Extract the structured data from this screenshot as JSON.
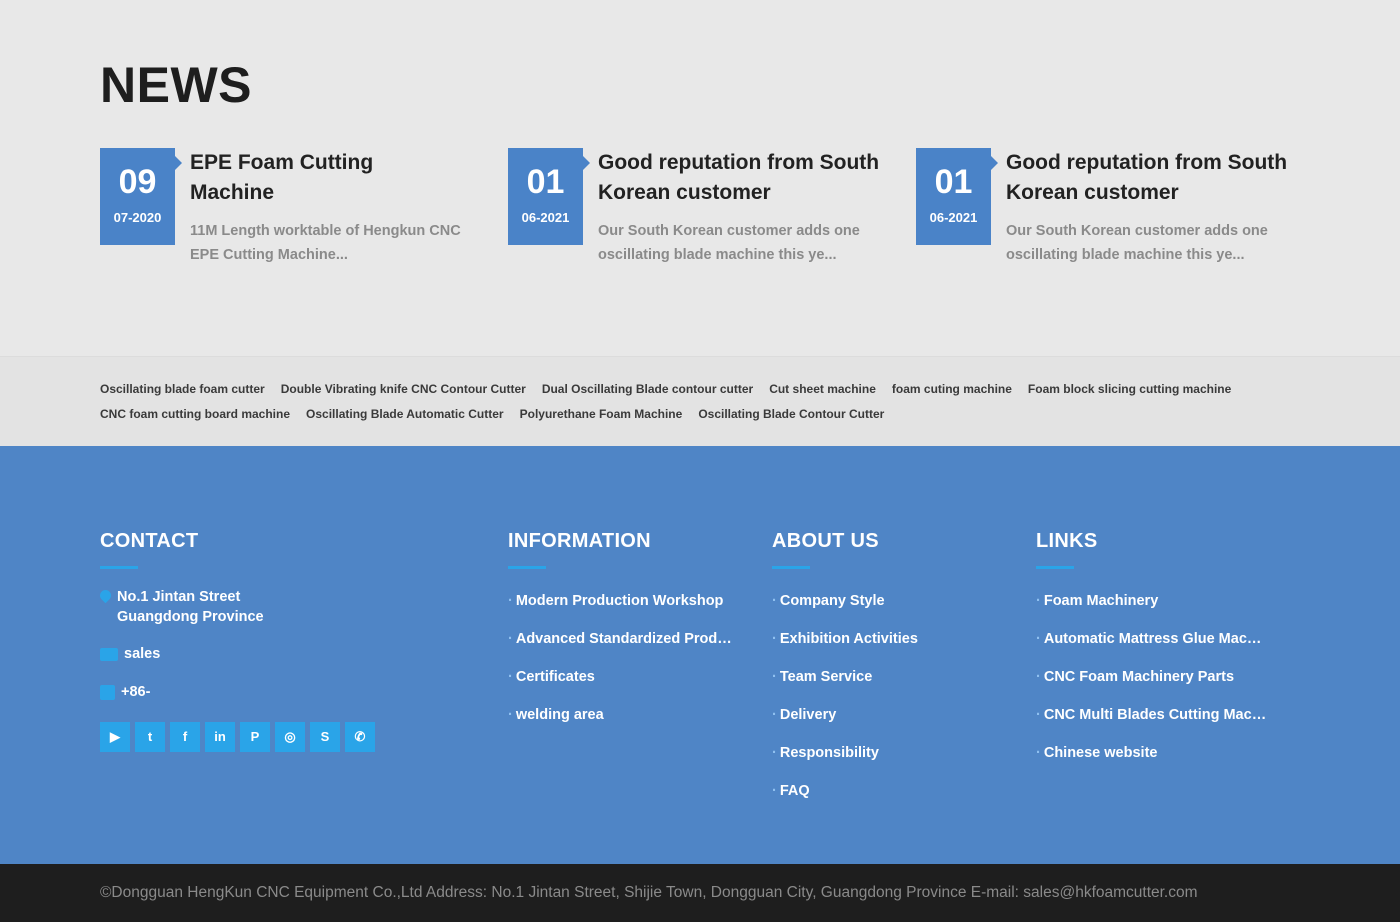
{
  "news": {
    "title": "NEWS",
    "items": [
      {
        "day": "09",
        "ym": "07-2020",
        "title": "EPE Foam Cutting Machine",
        "desc": "11M Length worktable of Hengkun CNC EPE Cutting Machine..."
      },
      {
        "day": "01",
        "ym": "06-2021",
        "title": "Good reputation from South Korean customer",
        "desc": "Our South Korean customer adds one oscillating blade machine this ye..."
      },
      {
        "day": "01",
        "ym": "06-2021",
        "title": "Good reputation from South Korean customer",
        "desc": "Our South Korean customer adds one oscillating blade machine this ye..."
      }
    ]
  },
  "tags": {
    "row1": [
      "Oscillating blade foam cutter",
      "Double Vibrating knife CNC Contour Cutter",
      "Dual Oscillating Blade contour cutter",
      "Cut sheet machine",
      "foam cuting machine",
      "Foam block slicing cutting machine"
    ],
    "row2": [
      "CNC foam cutting board machine",
      "Oscillating Blade Automatic Cutter",
      "Polyurethane Foam Machine",
      "Oscillating Blade Contour Cutter"
    ]
  },
  "footer": {
    "contact": {
      "title": "CONTACT",
      "address_line1": "No.1 Jintan Street",
      "address_line2": "Guangdong Province",
      "email": "sales",
      "phone": "+86-",
      "social_icons": [
        "youtube-icon",
        "twitter-icon",
        "facebook-icon",
        "linkedin-icon",
        "pinterest-icon",
        "instagram-icon",
        "skype-icon",
        "whatsapp-icon"
      ]
    },
    "information": {
      "title": "INFORMATION",
      "items": [
        "Modern Production Workshop",
        "Advanced Standardized Production",
        "Certificates",
        "welding area"
      ]
    },
    "about": {
      "title": "ABOUT US",
      "items": [
        "Company Style",
        "Exhibition Activities",
        "Team Service",
        "Delivery",
        "Responsibility",
        "FAQ"
      ]
    },
    "links": {
      "title": "LINKS",
      "items": [
        "Foam Machinery",
        "Automatic Mattress Glue Machine",
        "CNC Foam Machinery Parts",
        "CNC Multi Blades Cutting Machine",
        "Chinese website"
      ]
    }
  },
  "copyright": "©Dongguan HengKun CNC Equipment  Co.,Ltd Address: No.1 Jintan Street, Shijie Town, Dongguan City, Guangdong Province E-mail: sales@hkfoamcutter.com",
  "colors": {
    "accent": "#4a83c8",
    "footer_bg": "#4f85c6",
    "highlight": "#2aa4e8",
    "bottom_bg": "#1e1e1e"
  }
}
